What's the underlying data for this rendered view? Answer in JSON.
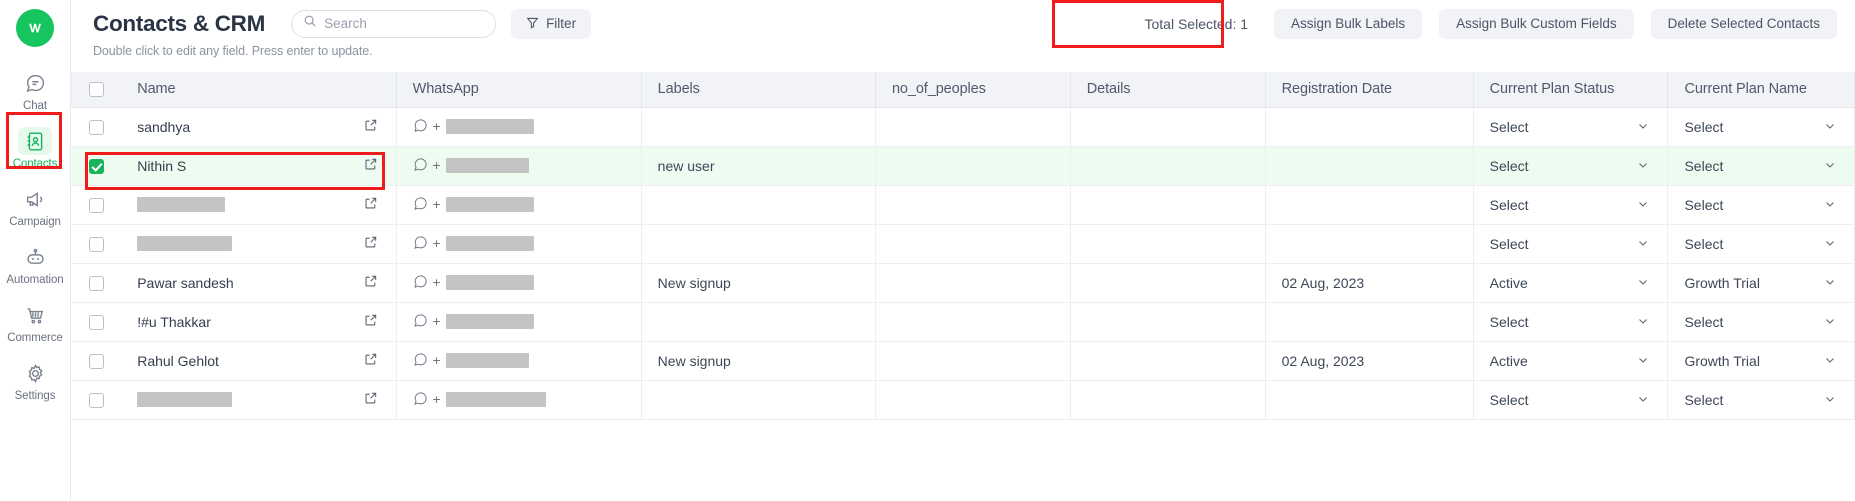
{
  "sidebar": {
    "logo_name": "whatsapp-logo",
    "items": [
      {
        "label": "Chat",
        "icon": "chat-icon",
        "active": false
      },
      {
        "label": "Contacts",
        "icon": "contacts-icon",
        "active": true
      },
      {
        "label": "Campaign",
        "icon": "megaphone-icon",
        "active": false
      },
      {
        "label": "Automation",
        "icon": "robot-icon",
        "active": false
      },
      {
        "label": "Commerce",
        "icon": "cart-icon",
        "active": false
      },
      {
        "label": "Settings",
        "icon": "gear-icon",
        "active": false
      }
    ]
  },
  "header": {
    "title": "Contacts & CRM",
    "subtitle": "Double click to edit any field. Press enter to update.",
    "search_placeholder": "Search",
    "search_value": "",
    "filter_label": "Filter",
    "total_selected": "Total Selected: 1",
    "assign_bulk_labels": "Assign Bulk Labels",
    "assign_bulk_custom_fields": "Assign Bulk Custom Fields",
    "delete_selected_contacts": "Delete Selected Contacts"
  },
  "table": {
    "columns": [
      "Name",
      "WhatsApp",
      "Labels",
      "no_of_peoples",
      "Details",
      "Registration Date",
      "Current Plan Status",
      "Current Plan Name"
    ],
    "rows": [
      {
        "selected": false,
        "name": "sandhya",
        "name_redacted": false,
        "redact_w": 0,
        "whatsapp": "",
        "wa_redact_w": 88,
        "labels": "",
        "no_of_peoples": "",
        "details": "",
        "registration_date": "",
        "plan_status": "Select",
        "plan_name": "Select"
      },
      {
        "selected": true,
        "name": "Nithin S",
        "name_redacted": false,
        "redact_w": 0,
        "whatsapp": "",
        "wa_redact_w": 83,
        "labels": "new user",
        "no_of_peoples": "",
        "details": "",
        "registration_date": "",
        "plan_status": "Select",
        "plan_name": "Select"
      },
      {
        "selected": false,
        "name": "",
        "name_redacted": true,
        "redact_w": 88,
        "whatsapp": "",
        "wa_redact_w": 88,
        "labels": "",
        "no_of_peoples": "",
        "details": "",
        "registration_date": "",
        "plan_status": "Select",
        "plan_name": "Select"
      },
      {
        "selected": false,
        "name": "",
        "name_redacted": true,
        "redact_w": 95,
        "whatsapp": "",
        "wa_redact_w": 88,
        "labels": "",
        "no_of_peoples": "",
        "details": "",
        "registration_date": "",
        "plan_status": "Select",
        "plan_name": "Select"
      },
      {
        "selected": false,
        "name": "Pawar sandesh",
        "name_redacted": false,
        "redact_w": 0,
        "whatsapp": "",
        "wa_redact_w": 88,
        "labels": "New signup",
        "no_of_peoples": "",
        "details": "",
        "registration_date": "02 Aug, 2023",
        "plan_status": "Active",
        "plan_name": "Growth Trial"
      },
      {
        "selected": false,
        "name": "!#u Thakkar",
        "name_redacted": false,
        "redact_w": 0,
        "whatsapp": "",
        "wa_redact_w": 88,
        "labels": "",
        "no_of_peoples": "",
        "details": "",
        "registration_date": "",
        "plan_status": "Select",
        "plan_name": "Select"
      },
      {
        "selected": false,
        "name": "Rahul Gehlot",
        "name_redacted": false,
        "redact_w": 0,
        "whatsapp": "",
        "wa_redact_w": 83,
        "labels": "New signup",
        "no_of_peoples": "",
        "details": "",
        "registration_date": "02 Aug, 2023",
        "plan_status": "Active",
        "plan_name": "Growth Trial"
      },
      {
        "selected": false,
        "name": "",
        "name_redacted": true,
        "redact_w": 95,
        "whatsapp": "",
        "wa_redact_w": 100,
        "labels": "",
        "no_of_peoples": "",
        "details": "",
        "registration_date": "",
        "plan_status": "Select",
        "plan_name": "Select"
      }
    ]
  },
  "colors": {
    "brand_green": "#17b45a",
    "annotation_red": "#f01c1c",
    "selected_row_bg": "#edfbf0",
    "header_bg": "#f1f3f7"
  }
}
